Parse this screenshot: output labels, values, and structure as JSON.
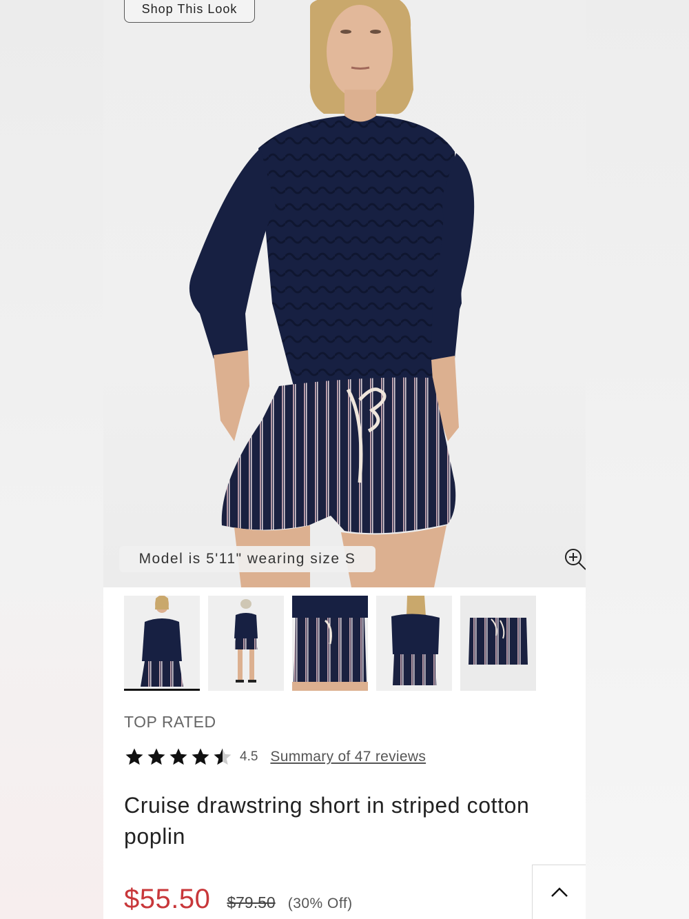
{
  "hero": {
    "shop_look_label": "Shop This Look",
    "model_note": "Model is 5'11\" wearing size S"
  },
  "thumbnails": [
    {
      "name": "front-full"
    },
    {
      "name": "full-body-hat"
    },
    {
      "name": "shorts-closeup"
    },
    {
      "name": "back-view"
    },
    {
      "name": "flat-lay"
    }
  ],
  "product": {
    "badge": "TOP RATED",
    "rating": 4.5,
    "rating_text": "4.5",
    "reviews_link": "Summary of 47 reviews",
    "title": "Cruise drawstring short in striped cotton poplin",
    "sale_price": "$55.50",
    "original_price": "$79.50",
    "discount": "(30% Off)"
  },
  "colors": {
    "sale": "#c8373a",
    "sweater": "#141d36",
    "shorts": "#1a2140",
    "stripe": "#b79aa6"
  },
  "icons": {
    "zoom": "zoom-in-icon",
    "back_to_top": "chevron-up-icon"
  }
}
